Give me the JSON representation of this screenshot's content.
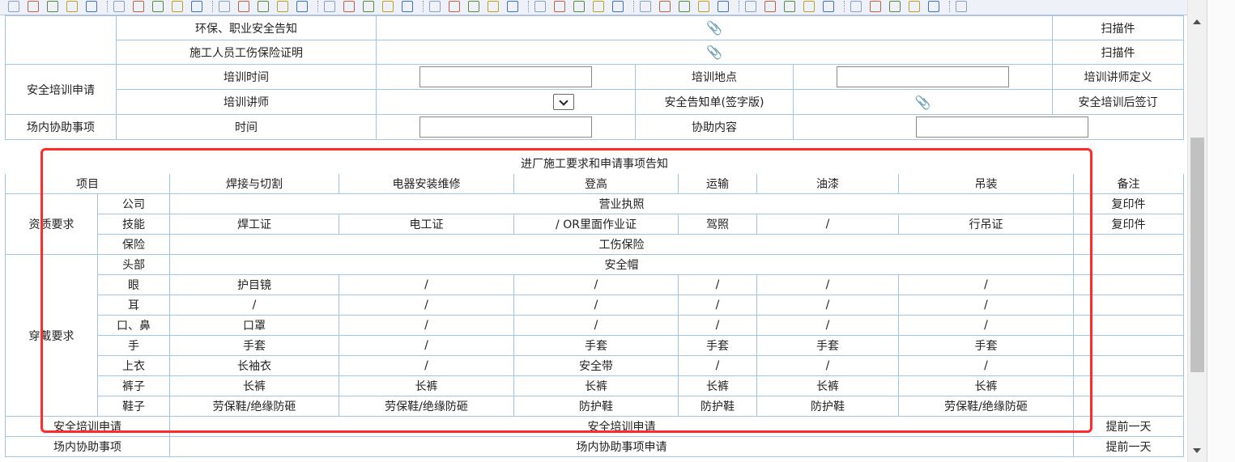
{
  "upper_table": {
    "row1_label": "环保、职业安全告知",
    "row1_right": "扫描件",
    "row2_label": "施工人员工伤保险证明",
    "row2_right": "扫描件",
    "training_section": "安全培训申请",
    "training_time": "培训时间",
    "training_place": "培训地点",
    "trainer_definition": "培训讲师定义",
    "trainer": "培训讲师",
    "safety_notice_signed": "安全告知单(签字版)",
    "post_training_sign": "安全培训后签订",
    "assist_section": "场内协助事项",
    "assist_time": "时间",
    "assist_content": "协助内容",
    "paperclip": "paperclip-icon"
  },
  "notice": {
    "title": "进厂施工要求和申请事项告知",
    "headers": [
      "项目",
      "焊接与切割",
      "电器安装维修",
      "登高",
      "运输",
      "油漆",
      "吊装",
      "备注"
    ],
    "qualification": {
      "label": "资质要求",
      "company": {
        "label": "公司",
        "value": "营业执照",
        "remark": "复印件"
      },
      "skill": {
        "label": "技能",
        "cells": [
          "焊工证",
          "电工证",
          "/ OR里面作业证",
          "驾照",
          "/",
          "行吊证"
        ],
        "remark": "复印件"
      },
      "insurance": {
        "label": "保险",
        "value": "工伤保险"
      }
    },
    "wear": {
      "label": "穿戴要求",
      "head": {
        "label": "头部",
        "value": "安全帽"
      },
      "rows": [
        {
          "label": "眼",
          "cells": [
            "护目镜",
            "/",
            "/",
            "/",
            "/",
            "/"
          ]
        },
        {
          "label": "耳",
          "cells": [
            "/",
            "/",
            "/",
            "/",
            "/",
            "/"
          ]
        },
        {
          "label": "口、鼻",
          "cells": [
            "口罩",
            "/",
            "/",
            "/",
            "/",
            "/"
          ]
        },
        {
          "label": "手",
          "cells": [
            "手套",
            "/",
            "手套",
            "手套",
            "手套",
            "手套"
          ]
        },
        {
          "label": "上衣",
          "cells": [
            "长袖衣",
            "/",
            "安全带",
            "/",
            "/",
            "/"
          ]
        },
        {
          "label": "裤子",
          "cells": [
            "长裤",
            "长裤",
            "长裤",
            "长裤",
            "长裤",
            "长裤"
          ]
        },
        {
          "label": "鞋子",
          "cells": [
            "劳保鞋/绝缘防砸",
            "劳保鞋/绝缘防砸",
            "防护鞋",
            "防护鞋",
            "防护鞋",
            "劳保鞋/绝缘防砸"
          ]
        }
      ]
    },
    "training_row": {
      "label": "安全培训申请",
      "value": "安全培训申请",
      "remark": "提前一天"
    },
    "assist_row": {
      "label": "场内协助事项",
      "value": "场内协助事项申请",
      "remark": "提前一天"
    }
  }
}
